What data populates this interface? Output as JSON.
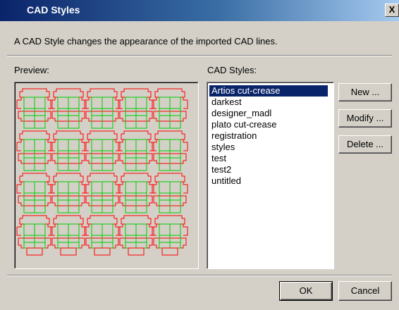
{
  "window": {
    "title": "CAD Styles",
    "close_label": "X"
  },
  "description": "A CAD Style changes the appearance of the imported CAD lines.",
  "preview": {
    "label": "Preview:"
  },
  "styles_list": {
    "label": "CAD Styles:",
    "items": [
      "Artios cut-crease",
      "darkest",
      "designer_madl",
      "plato cut-crease",
      "registration",
      "styles",
      "test",
      "test2",
      "untitled"
    ],
    "selected_index": 0
  },
  "buttons": {
    "new": "New ...",
    "modify": "Modify ...",
    "delete": "Delete ...",
    "ok": "OK",
    "cancel": "Cancel"
  },
  "colors": {
    "cut_line": "#ff0000",
    "crease_line": "#00cc00",
    "selection": "#0a246a",
    "titlebar": "#0a246a"
  }
}
